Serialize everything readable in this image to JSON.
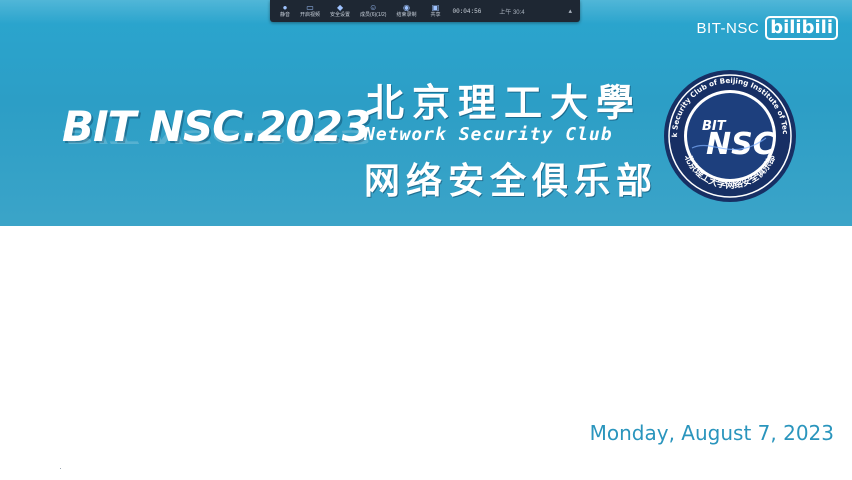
{
  "meeting_toolbar": {
    "items": [
      {
        "icon": "mic-icon",
        "label": "静音"
      },
      {
        "icon": "video-icon",
        "label": "开启视频"
      },
      {
        "icon": "security-icon",
        "label": "安全设置"
      },
      {
        "icon": "participants-icon",
        "label": "成员(6)(1/2)"
      },
      {
        "icon": "record-icon",
        "label": "结束录制"
      }
    ],
    "share": {
      "icon": "share-screen-icon",
      "label": "共享"
    },
    "timer": "00:04:56",
    "more": "上午 30:4"
  },
  "banner": {
    "brand_title": "BIT NSC.2023",
    "university_name": "北京理工大學",
    "club_name_en": "Network Security Club",
    "club_name_cn": "网络安全俱乐部",
    "seal": {
      "outer_text": "Network Security Club of Beijing Institute of Technology",
      "inner_text_bottom": "北京理工大学网络安全俱乐部",
      "center_text_top": "BIT",
      "center_text_main": "NSC"
    },
    "colors": {
      "banner": "#2aa6cf",
      "seal_navy": "#172f64",
      "seal_ring": "#ffffff"
    }
  },
  "watermark": {
    "text": "BIT-NSC",
    "logo": "bilibili"
  },
  "slide": {
    "date": "Monday, August 7, 2023",
    "date_color": "#2a95bd"
  }
}
